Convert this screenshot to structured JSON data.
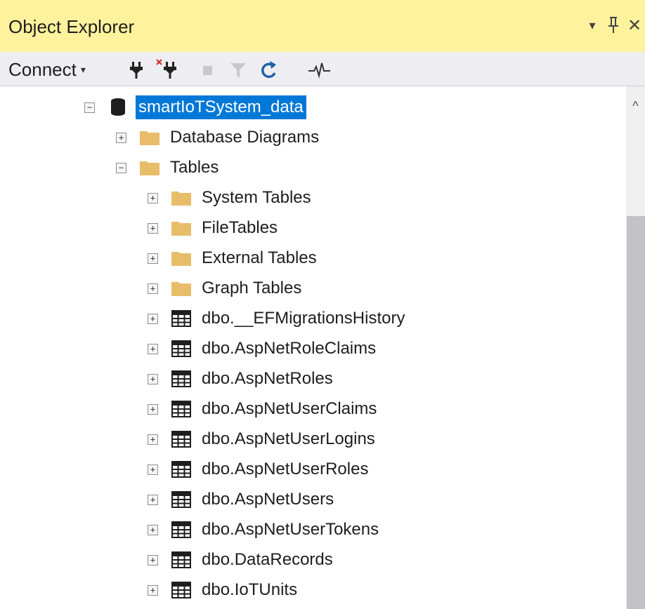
{
  "panel": {
    "title": "Object Explorer",
    "controls": [
      {
        "name": "dropdown-icon",
        "glyph": "▾"
      },
      {
        "name": "pin-icon",
        "glyph": "ꟼ"
      },
      {
        "name": "close-icon",
        "glyph": "✕"
      }
    ]
  },
  "toolbar": {
    "connect_label": "Connect",
    "connect_caret": "▾",
    "icons": [
      "connect-plug-icon",
      "disconnect-plug-icon",
      "stop-icon",
      "filter-icon",
      "refresh-icon",
      "activity-monitor-icon"
    ]
  },
  "tree": {
    "database": {
      "label": "smartIoTSystem_data",
      "expanded": true,
      "selected": true
    },
    "items": [
      {
        "label": "Database Diagrams",
        "type": "folder",
        "expanded": false
      },
      {
        "label": "Tables",
        "type": "folder",
        "expanded": true
      },
      {
        "label": "System Tables",
        "type": "folder",
        "expanded": false
      },
      {
        "label": "FileTables",
        "type": "folder",
        "expanded": false
      },
      {
        "label": "External Tables",
        "type": "folder",
        "expanded": false
      },
      {
        "label": "Graph Tables",
        "type": "folder",
        "expanded": false
      },
      {
        "label": "dbo.__EFMigrationsHistory",
        "type": "table",
        "expanded": false
      },
      {
        "label": "dbo.AspNetRoleClaims",
        "type": "table",
        "expanded": false
      },
      {
        "label": "dbo.AspNetRoles",
        "type": "table",
        "expanded": false
      },
      {
        "label": "dbo.AspNetUserClaims",
        "type": "table",
        "expanded": false
      },
      {
        "label": "dbo.AspNetUserLogins",
        "type": "table",
        "expanded": false
      },
      {
        "label": "dbo.AspNetUserRoles",
        "type": "table",
        "expanded": false
      },
      {
        "label": "dbo.AspNetUsers",
        "type": "table",
        "expanded": false
      },
      {
        "label": "dbo.AspNetUserTokens",
        "type": "table",
        "expanded": false
      },
      {
        "label": "dbo.DataRecords",
        "type": "table",
        "expanded": false
      },
      {
        "label": "dbo.IoTUnits",
        "type": "table",
        "expanded": false
      }
    ]
  },
  "scrollbar": {
    "up_glyph": "^"
  },
  "colors": {
    "title_bg": "#fff29d",
    "toolbar_bg": "#eeeef2",
    "selection": "#0078d7",
    "folder": "#e8bd6a"
  }
}
